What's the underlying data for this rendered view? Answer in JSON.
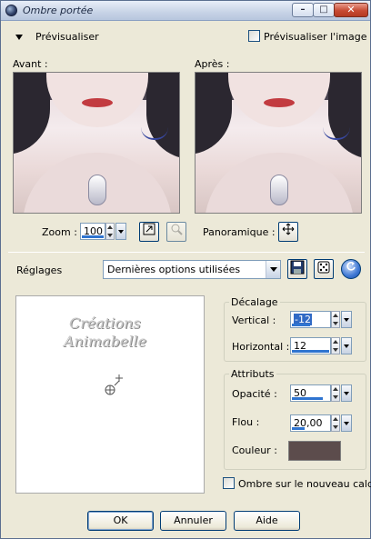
{
  "window": {
    "title": "Ombre portée"
  },
  "preview": {
    "toggle_label": "Prévisualiser",
    "preview_image_label": "Prévisualiser l'image",
    "before_label": "Avant :",
    "after_label": "Après :",
    "zoom_label": "Zoom :",
    "zoom_value": "100",
    "pan_label": "Panoramique :"
  },
  "settings": {
    "label": "Réglages",
    "preset_value": "Dernières options utilisées"
  },
  "canvas": {
    "watermark_line1": "Créations",
    "watermark_line2": "Animabelle"
  },
  "offset": {
    "title": "Décalage",
    "vertical_label": "Vertical :",
    "vertical_value": "-12",
    "horizontal_label": "Horizontal :",
    "horizontal_value": "12"
  },
  "attributes": {
    "title": "Attributs",
    "opacity_label": "Opacité :",
    "opacity_value": "50",
    "blur_label": "Flou :",
    "blur_value": "20,00",
    "color_label": "Couleur :",
    "color": "#5c4c4c"
  },
  "new_layer_label": "Ombre sur le nouveau calque",
  "buttons": {
    "ok": "OK",
    "cancel": "Annuler",
    "help": "Aide"
  },
  "icons": {
    "window": "app-icon",
    "fit": "fit-window-icon",
    "zoom_actual": "zoom-actual-icon",
    "pan": "pan-crosshair-icon",
    "save": "save-preset-icon",
    "random": "randomize-dice-icon",
    "reset": "reset-icon"
  },
  "accent": "#2f74d0"
}
